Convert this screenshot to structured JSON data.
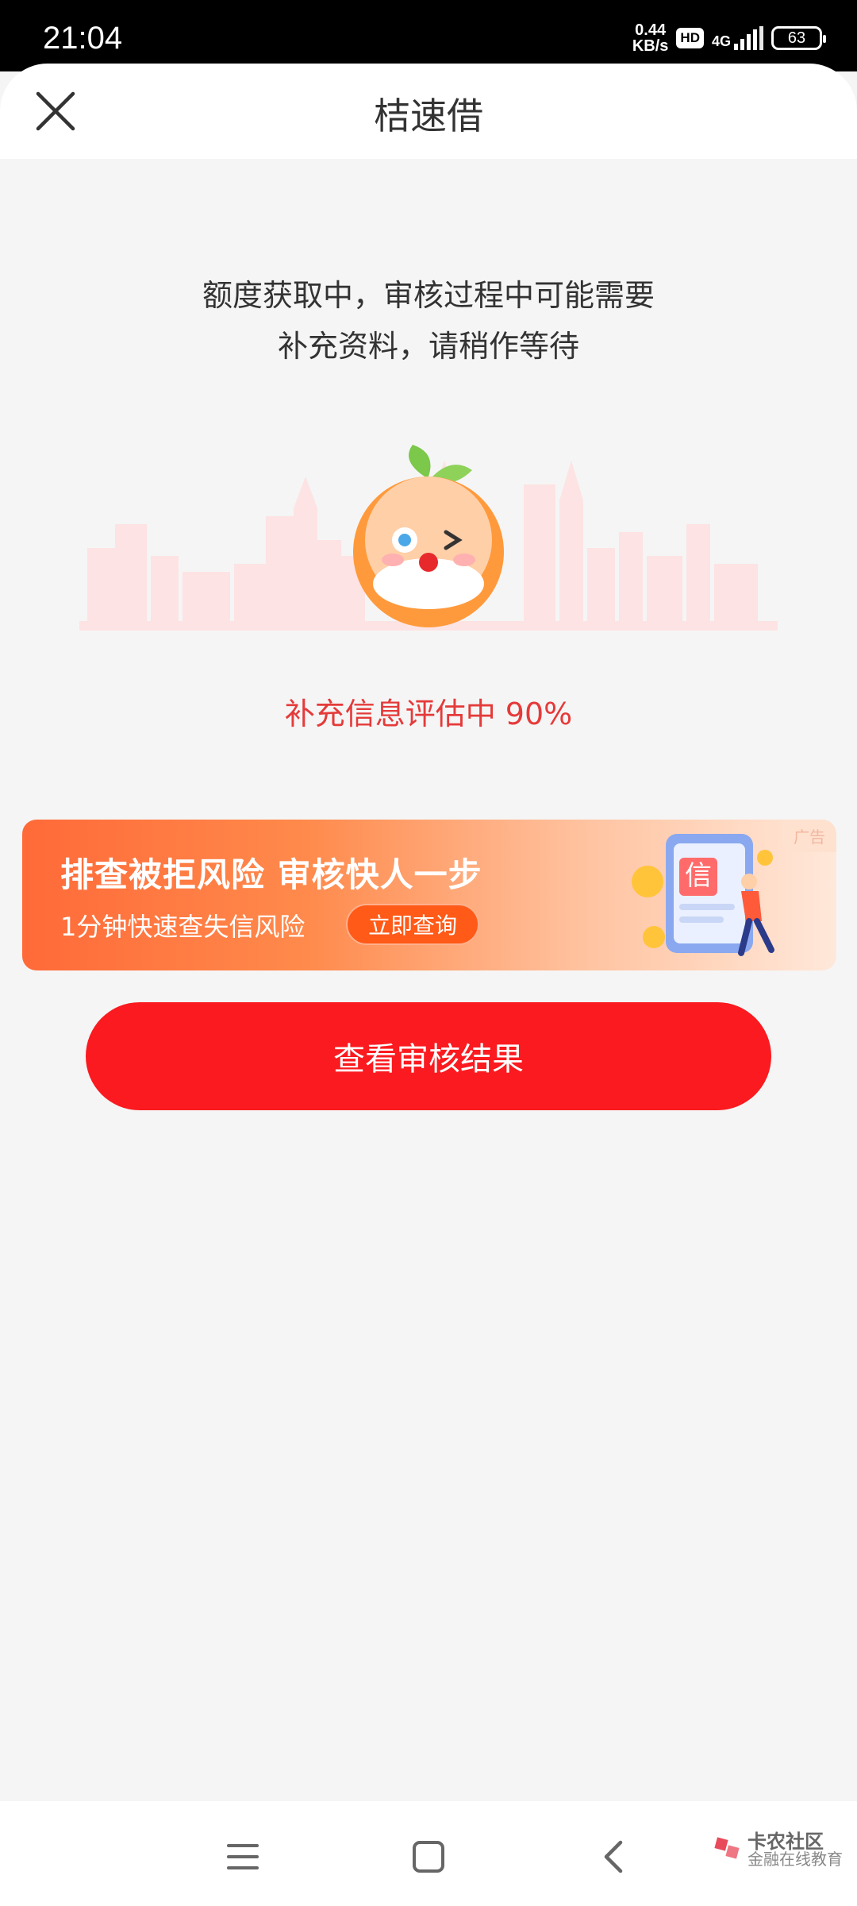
{
  "status_bar": {
    "time": "21:04",
    "speed_value": "0.44",
    "speed_unit": "KB/s",
    "hd": "HD",
    "network": "4G",
    "battery": "63"
  },
  "header": {
    "title": "桔速借",
    "close_icon": "close-icon"
  },
  "message": {
    "line1": "额度获取中，审核过程中可能需要",
    "line2": "补充资料，请稍作等待"
  },
  "progress": {
    "label": "补充信息评估中 90%",
    "percent": 90
  },
  "ad_banner": {
    "tag": "广告",
    "title": "排查被拒风险  审核快人一步",
    "subtitle": "1分钟快速查失信风险",
    "button": "立即查询",
    "art_text": "信"
  },
  "primary_button": {
    "label": "查看审核结果"
  },
  "nav_bar": {
    "watermark_title": "卡农社区",
    "watermark_sub": "金融在线教育"
  },
  "colors": {
    "accent": "#fa1a1f",
    "progress_text": "#e53a3a",
    "banner_start": "#ff6a38",
    "banner_end": "#ffe8da"
  }
}
